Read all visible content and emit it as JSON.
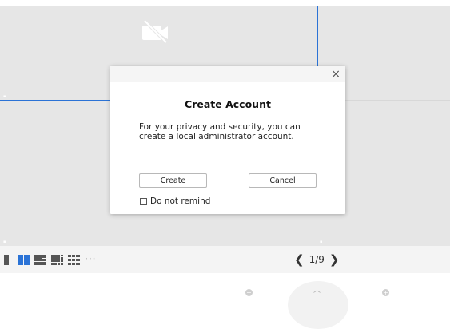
{
  "modal": {
    "title": "Create Account",
    "message": "For your privacy and security, you can create a local administrator account.",
    "close_glyph": "×",
    "create_label": "Create",
    "cancel_label": "Cancel",
    "do_not_remind_label": "Do not remind",
    "do_not_remind_checked": false
  },
  "toolbar": {
    "layout_options": [
      "single-layout",
      "4-grid-layout",
      "6-split-layout",
      "8-split-layout",
      "9-grid-layout"
    ],
    "active_layout": "4-grid-layout",
    "more_glyph": "···",
    "pager": {
      "prev_glyph": "❮",
      "text": "1/9",
      "next_glyph": "❯"
    }
  },
  "video": {
    "camera_status_icon": "camera-off-icon"
  },
  "colors": {
    "selection": "#2b73d6",
    "active_layout": "#2b73d6",
    "video_bg": "#e6e6e6",
    "toolbar_bg": "#f4f4f4"
  }
}
